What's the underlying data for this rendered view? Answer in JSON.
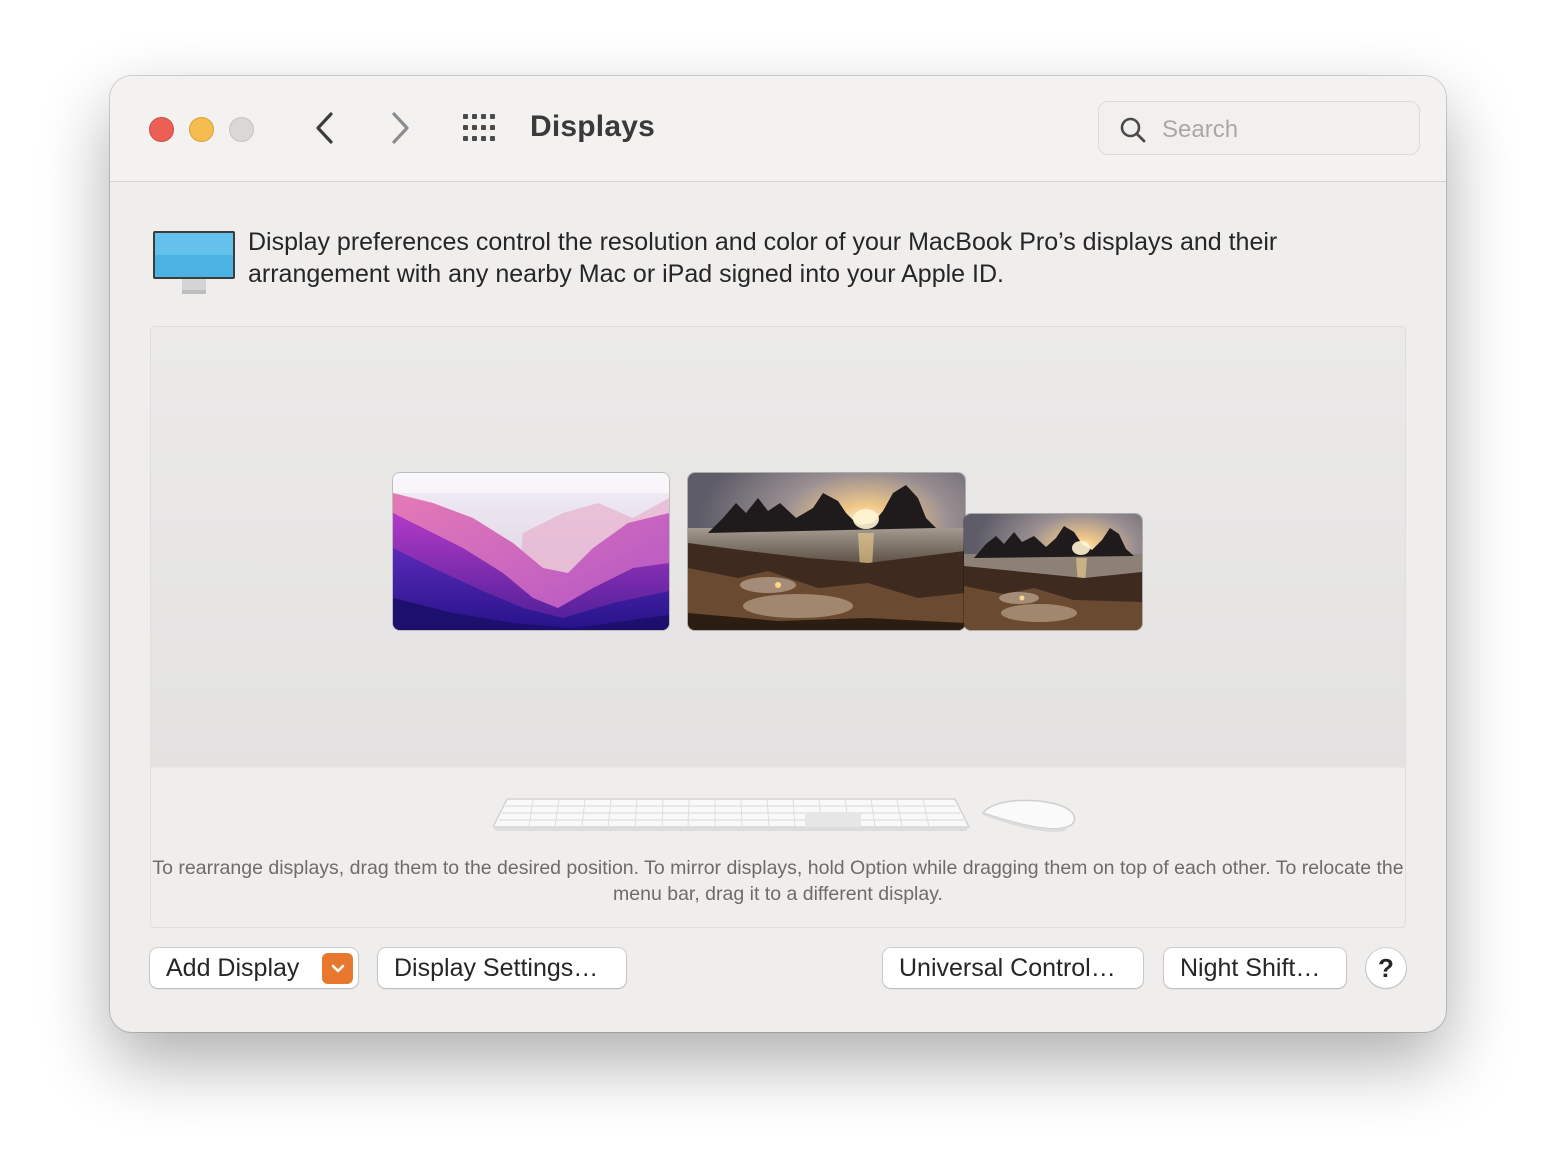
{
  "window": {
    "title": "Displays",
    "traffic_lights": [
      "close",
      "minimize",
      "zoom"
    ],
    "nav": {
      "back_icon": "chevron-left-icon",
      "forward_icon": "chevron-right-icon",
      "grid_icon": "show-all-grid-icon"
    },
    "search": {
      "placeholder": "Search",
      "value": "",
      "icon": "search-icon"
    }
  },
  "intro": {
    "icon": "display-monitor-icon",
    "text": "Display preferences control the resolution and color of your MacBook Pro’s displays and their arrangement with any nearby Mac or iPad signed into your Apple ID."
  },
  "arrangement": {
    "displays": [
      {
        "name": "display-1",
        "wallpaper": "purple-mountains",
        "has_menu_bar": true
      },
      {
        "name": "display-2",
        "wallpaper": "rocky-sunset",
        "has_menu_bar": false
      },
      {
        "name": "display-3",
        "wallpaper": "rocky-sunset",
        "has_menu_bar": false
      }
    ],
    "peripherals": [
      "keyboard-icon",
      "mouse-icon"
    ],
    "hint": "To rearrange displays, drag them to the desired position. To mirror displays, hold Option while dragging them on top of each other. To relocate the menu bar, drag it to a different display."
  },
  "buttons": {
    "add_display": "Add Display",
    "display_settings": "Display Settings…",
    "universal_control": "Universal Control…",
    "night_shift": "Night Shift…",
    "help": "?"
  },
  "colors": {
    "close": "#ec5f57",
    "minimize": "#f5bd4f",
    "zoom": "#d9d8d7",
    "accent": "#e8782d",
    "monitor_screen": "#4ab3e4"
  }
}
